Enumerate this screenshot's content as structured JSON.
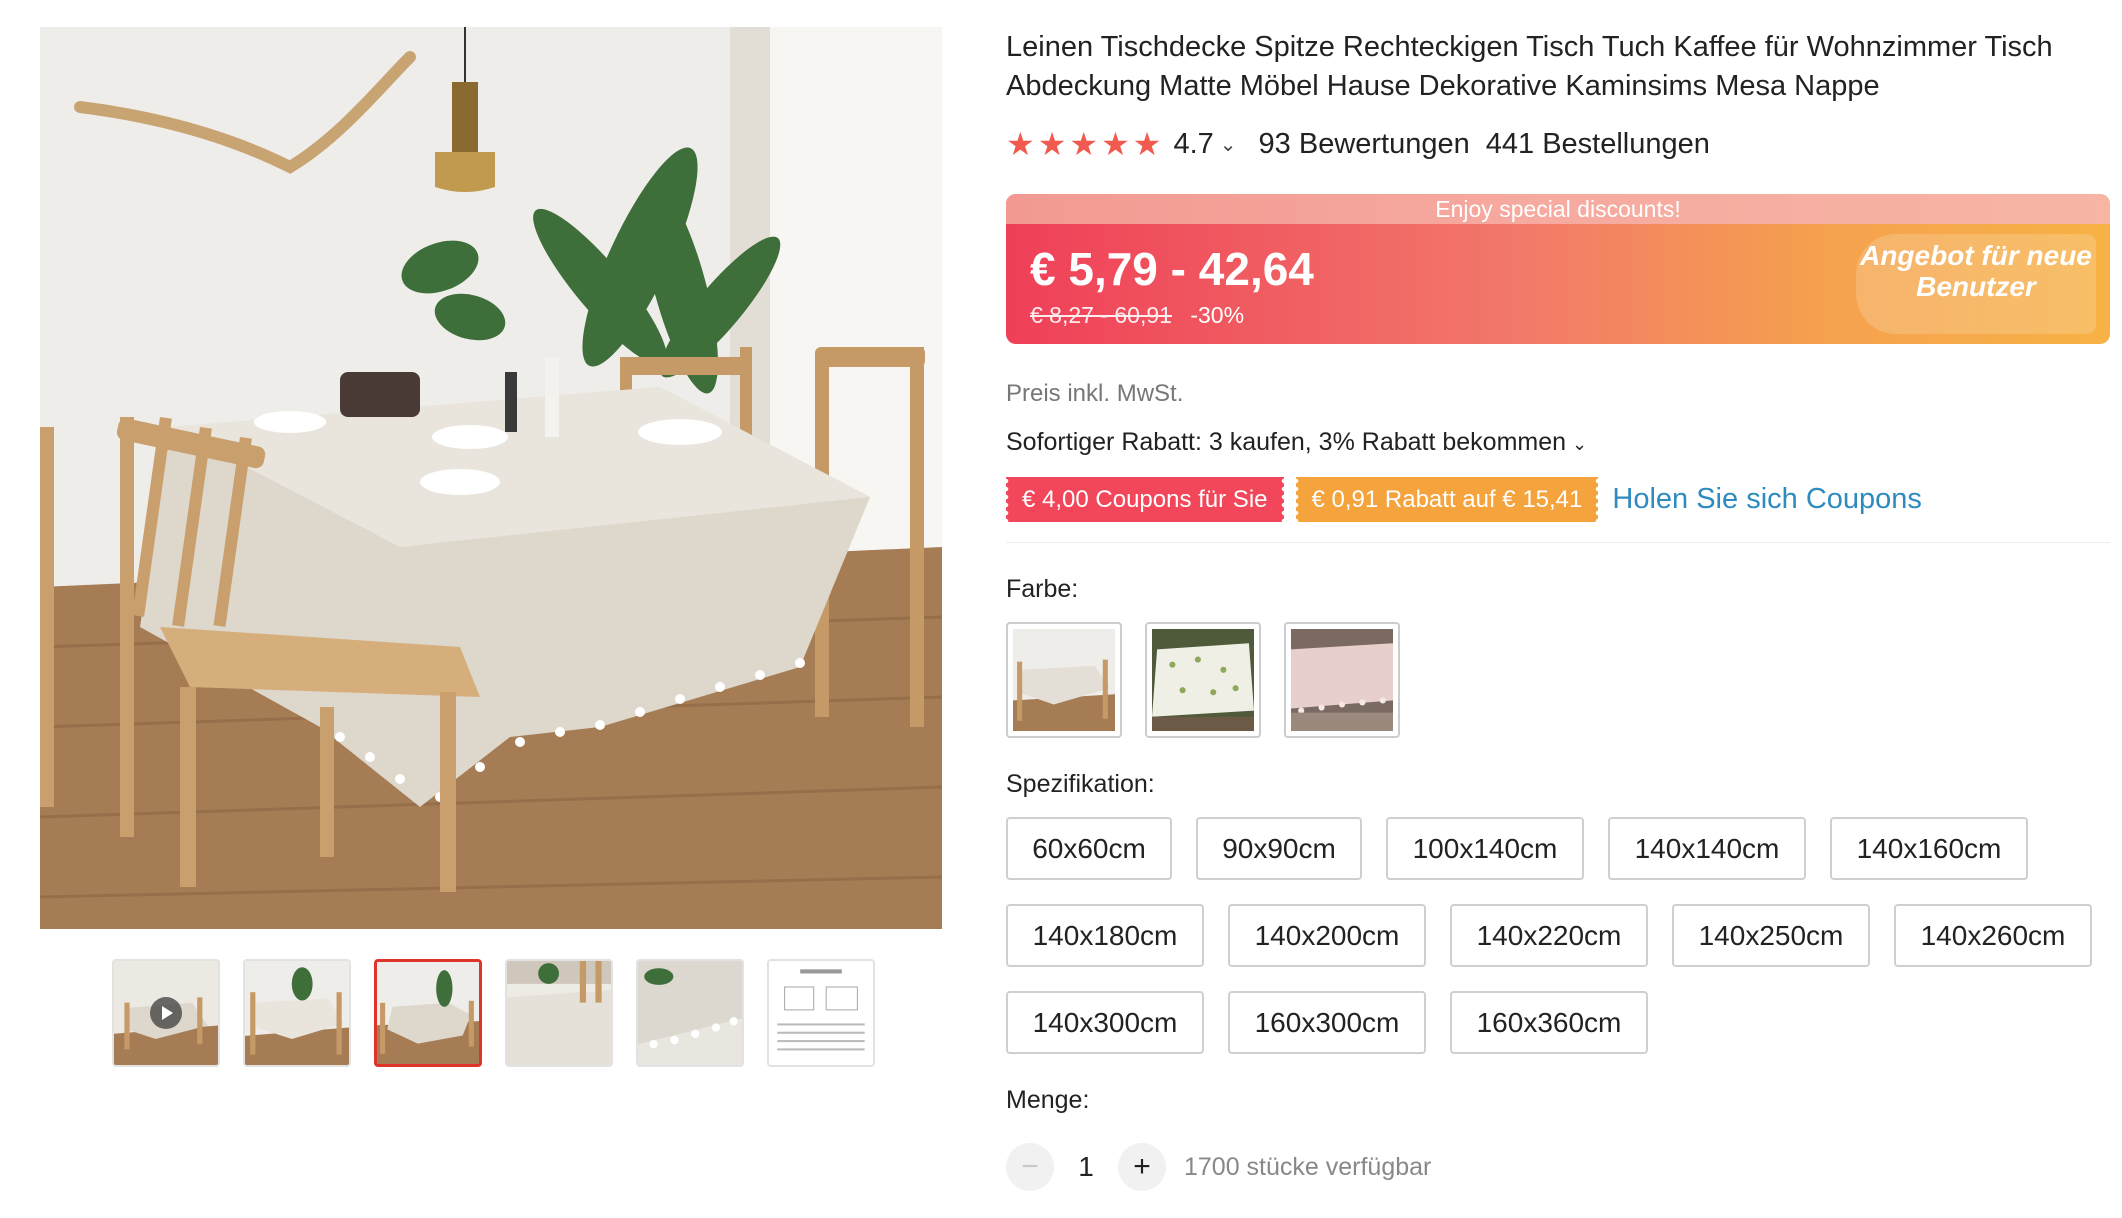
{
  "product": {
    "title": "Leinen Tischdecke Spitze Rechteckigen Tisch Tuch Kaffee für Wohnzimmer Tisch Abdeckung Matte Möbel Hause Dekorative Kaminsims Mesa Nappe"
  },
  "rating": {
    "stars": 5,
    "value": "4.7",
    "reviews": "93 Bewertungen",
    "orders": "441 Bestellungen"
  },
  "price": {
    "banner_top": "Enjoy special discounts!",
    "range": "€ 5,79 - 42,64",
    "original": "€ 8,27 - 60,91",
    "discount": "-30%",
    "new_user_badge": "Angebot für neue Benutzer"
  },
  "tax_note": "Preis inkl. MwSt.",
  "bulk_discount": "Sofortiger Rabatt: 3 kaufen, 3% Rabatt bekommen",
  "coupons": {
    "coupon_1": "€ 4,00 Coupons für Sie",
    "coupon_2": "€ 0,91 Rabatt auf € 15,41",
    "link": "Holen Sie sich Coupons"
  },
  "color": {
    "label": "Farbe:",
    "options": [
      "beige-tassel",
      "floral-white",
      "pink-lace"
    ]
  },
  "spec": {
    "label": "Spezifikation:",
    "options": [
      "60x60cm",
      "90x90cm",
      "100x140cm",
      "140x140cm",
      "140x160cm",
      "140x180cm",
      "140x200cm",
      "140x220cm",
      "140x250cm",
      "140x260cm",
      "140x300cm",
      "160x300cm",
      "160x360cm"
    ]
  },
  "quantity": {
    "label": "Menge:",
    "value": "1",
    "minus": "−",
    "plus": "+",
    "available": "1700 stücke verfügbar"
  },
  "gallery": {
    "selected_index": 2,
    "thumbs": [
      "video",
      "table-overview",
      "table-dining",
      "table-closeup",
      "tassel-detail",
      "size-chart"
    ]
  },
  "colors": {
    "accent_red": "#e0332a",
    "star": "#f05a4f",
    "link": "#2e8bbf",
    "coupon_red": "#f2475a",
    "coupon_orange": "#f5a33c"
  }
}
